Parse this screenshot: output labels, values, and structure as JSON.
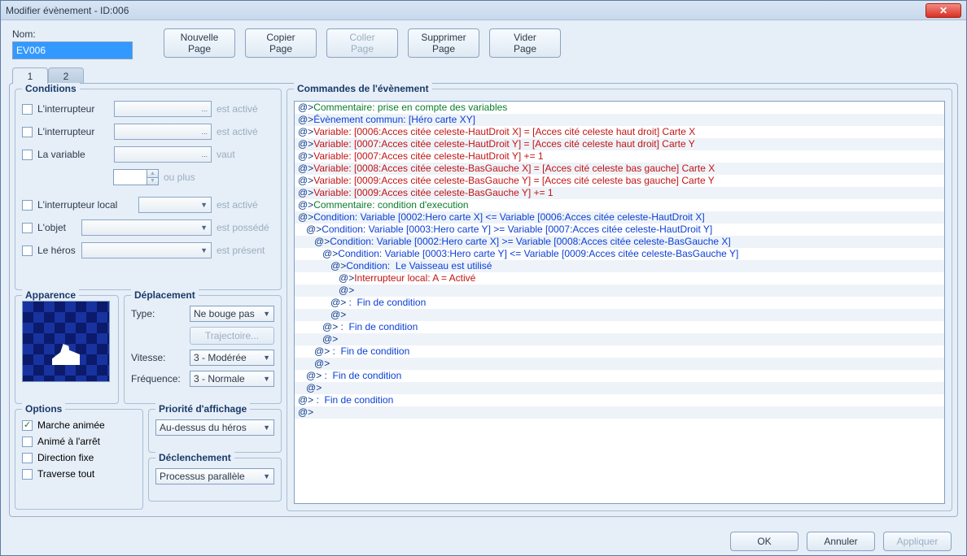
{
  "window": {
    "title": "Modifier évènement - ID:006"
  },
  "top": {
    "name_label": "Nom:",
    "name_value": "EV006",
    "buttons": {
      "new1": "Nouvelle",
      "new2": "Page",
      "copy1": "Copier",
      "copy2": "Page",
      "paste1": "Coller",
      "paste2": "Page",
      "del1": "Supprimer",
      "del2": "Page",
      "clear1": "Vider",
      "clear2": "Page"
    }
  },
  "tabs": {
    "t1": "1",
    "t2": "2"
  },
  "conditions": {
    "legend": "Conditions",
    "sw1": "L'interrupteur",
    "sw1_suffix": "est activé",
    "sw2": "L'interrupteur",
    "sw2_suffix": "est activé",
    "var": "La variable",
    "var_suffix": "vaut",
    "var_more": "ou plus",
    "selfsw": "L'interrupteur local",
    "selfsw_suffix": "est activé",
    "item": "L'objet",
    "item_suffix": "est possédé",
    "actor": "Le héros",
    "actor_suffix": "est présent",
    "ellipsis": "..."
  },
  "appearance": {
    "legend": "Apparence"
  },
  "deplacement": {
    "legend": "Déplacement",
    "type_label": "Type:",
    "type_value": "Ne bouge pas",
    "traj_label": "Trajectoire...",
    "speed_label": "Vitesse:",
    "speed_value": "3 - Modérée",
    "freq_label": "Fréquence:",
    "freq_value": "3 - Normale"
  },
  "options": {
    "legend": "Options",
    "walk": "Marche animée",
    "step": "Animé à l'arrêt",
    "dirfix": "Direction fixe",
    "through": "Traverse tout"
  },
  "priority": {
    "legend": "Priorité d'affichage",
    "value": "Au-dessus du héros"
  },
  "trigger": {
    "legend": "Déclenchement",
    "value": "Processus parallèle"
  },
  "commands": {
    "legend": "Commandes de l'évènement",
    "lines": [
      {
        "indent": 0,
        "cls": "c-green",
        "text": "Commentaire: prise en compte des variables"
      },
      {
        "indent": 0,
        "cls": "c-blue",
        "text": "Évènement commun: [Héro carte XY]"
      },
      {
        "indent": 0,
        "cls": "c-red",
        "text": "Variable: [0006:Acces citée celeste-HautDroit X] = [Acces cité celeste haut droit] Carte X"
      },
      {
        "indent": 0,
        "cls": "c-red",
        "text": "Variable: [0007:Acces citée celeste-HautDroit Y] = [Acces cité celeste haut droit] Carte Y"
      },
      {
        "indent": 0,
        "cls": "c-red",
        "text": "Variable: [0007:Acces citée celeste-HautDroit Y] += 1"
      },
      {
        "indent": 0,
        "cls": "c-red",
        "text": "Variable: [0008:Acces citée celeste-BasGauche X] = [Acces cité celeste bas gauche] Carte X"
      },
      {
        "indent": 0,
        "cls": "c-red",
        "text": "Variable: [0009:Acces citée celeste-BasGauche Y] = [Acces cité celeste bas gauche] Carte Y"
      },
      {
        "indent": 0,
        "cls": "c-red",
        "text": "Variable: [0009:Acces citée celeste-BasGauche Y] += 1"
      },
      {
        "indent": 0,
        "cls": "c-green",
        "text": "Commentaire: condition d'execution"
      },
      {
        "indent": 0,
        "cls": "c-blue",
        "text": "Condition: Variable [0002:Hero carte X] <= Variable [0006:Acces citée celeste-HautDroit X]"
      },
      {
        "indent": 1,
        "cls": "c-blue",
        "text": "Condition: Variable [0003:Hero carte Y] >= Variable [0007:Acces citée celeste-HautDroit Y]"
      },
      {
        "indent": 2,
        "cls": "c-blue",
        "text": "Condition: Variable [0002:Hero carte X] >= Variable [0008:Acces citée celeste-BasGauche X]"
      },
      {
        "indent": 3,
        "cls": "c-blue",
        "text": "Condition: Variable [0003:Hero carte Y] <= Variable [0009:Acces citée celeste-BasGauche Y]"
      },
      {
        "indent": 4,
        "cls": "c-blue",
        "text": "Condition:  Le Vaisseau est utilisé"
      },
      {
        "indent": 5,
        "cls": "c-red",
        "text": "Interrupteur local: A = Activé"
      },
      {
        "indent": 5,
        "cls": "c-black",
        "text": ""
      },
      {
        "indent": 4,
        "cls": "c-blue",
        "text": " :  Fin de condition"
      },
      {
        "indent": 4,
        "cls": "c-black",
        "text": ""
      },
      {
        "indent": 3,
        "cls": "c-blue",
        "text": " :  Fin de condition"
      },
      {
        "indent": 3,
        "cls": "c-black",
        "text": ""
      },
      {
        "indent": 2,
        "cls": "c-blue",
        "text": " :  Fin de condition"
      },
      {
        "indent": 2,
        "cls": "c-black",
        "text": ""
      },
      {
        "indent": 1,
        "cls": "c-blue",
        "text": " :  Fin de condition"
      },
      {
        "indent": 1,
        "cls": "c-black",
        "text": ""
      },
      {
        "indent": 0,
        "cls": "c-blue",
        "text": " :  Fin de condition"
      },
      {
        "indent": 0,
        "cls": "c-black",
        "text": ""
      }
    ]
  },
  "footer": {
    "ok": "OK",
    "cancel": "Annuler",
    "apply": "Appliquer"
  }
}
